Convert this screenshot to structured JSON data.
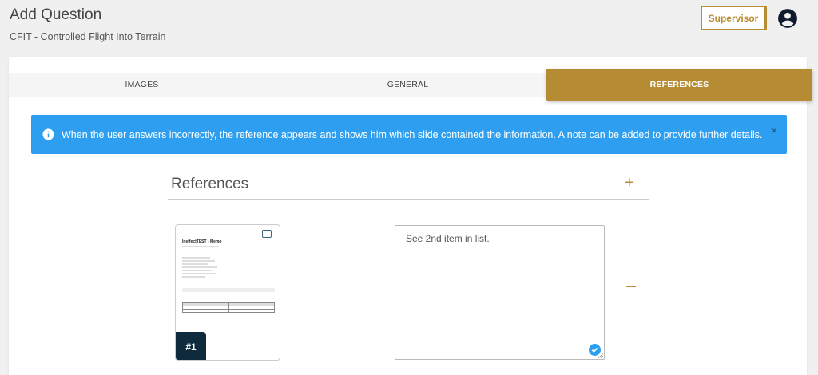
{
  "header": {
    "title": "Add Question",
    "subtitle": "CFIT - Controlled Flight Into Terrain"
  },
  "toolbar": {
    "supervisor_label": "Supervisor",
    "profile_icon": "account-circle-icon"
  },
  "tabs": [
    {
      "label": "IMAGES",
      "active": false
    },
    {
      "label": "GENERAL",
      "active": false
    },
    {
      "label": "REFERENCES",
      "active": true
    }
  ],
  "alert": {
    "message": "When the user answers incorrectly, the reference appears and shows him which slide contained the information. A note can be added to provide further details.",
    "icon": "info-icon",
    "close": "×",
    "color": "#2e9ff0"
  },
  "references": {
    "title": "References",
    "add": "+",
    "items": [
      {
        "badge": "#1",
        "thumbnail": {
          "doc_title": "IneffectTEST - Memo"
        },
        "note": "See 2nd item in list."
      }
    ]
  },
  "colors": {
    "accent": "#b58b34",
    "info": "#2e9ff0",
    "badge": "#0f2a3d"
  }
}
